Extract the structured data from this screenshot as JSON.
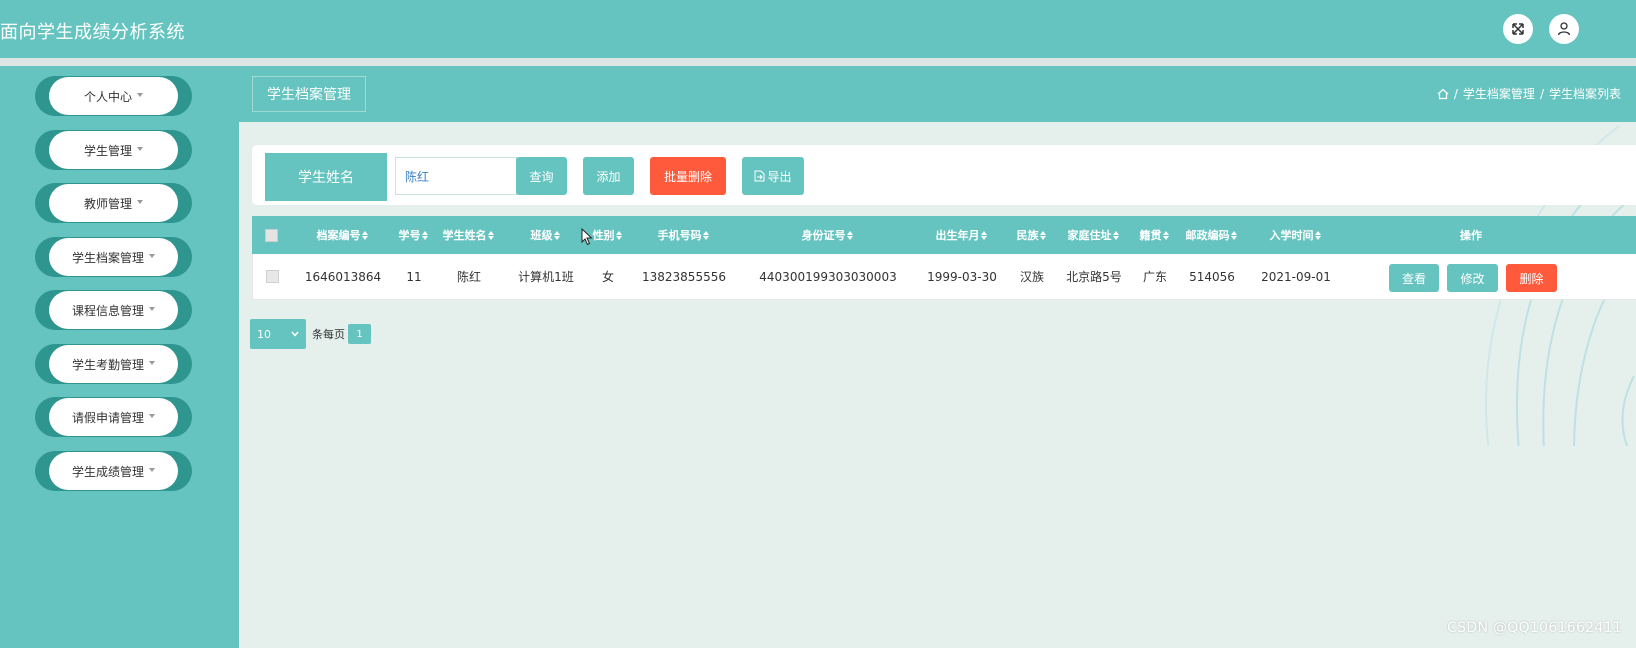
{
  "app": {
    "title": "面向学生成绩分析系统"
  },
  "topbar": {
    "fullscreen_icon": "fullscreen-icon",
    "user_icon": "user-icon"
  },
  "sidebar": {
    "items": [
      {
        "label": "个人中心"
      },
      {
        "label": "学生管理"
      },
      {
        "label": "教师管理"
      },
      {
        "label": "学生档案管理"
      },
      {
        "label": "课程信息管理"
      },
      {
        "label": "学生考勤管理"
      },
      {
        "label": "请假申请管理"
      },
      {
        "label": "学生成绩管理"
      }
    ]
  },
  "page": {
    "tag": "学生档案管理"
  },
  "breadcrumb": {
    "home_icon": "home-icon",
    "sep": "/",
    "level1": "学生档案管理",
    "level2": "学生档案列表"
  },
  "search": {
    "label": "学生姓名",
    "value": "陈红",
    "query_btn": "查询",
    "add_btn": "添加",
    "batch_delete_btn": "批量删除",
    "export_btn": "导出"
  },
  "table": {
    "columns": [
      "档案编号",
      "学号",
      "学生姓名",
      "班级",
      "性别",
      "手机号码",
      "身份证号",
      "出生年月",
      "民族",
      "家庭住址",
      "籍贯",
      "邮政编码",
      "入学时间",
      "操作"
    ],
    "rows": [
      {
        "cells": [
          "1646013864",
          "11",
          "陈红",
          "计算机1班",
          "女",
          "13823855556",
          "440300199303030003",
          "1999-03-30",
          "汉族",
          "北京路5号",
          "广东",
          "514056",
          "2021-09-01"
        ]
      }
    ],
    "actions": {
      "view": "查看",
      "edit": "修改",
      "delete": "删除"
    }
  },
  "pager": {
    "page_size": "10",
    "per_page_label": "条每页",
    "current_page": "1"
  },
  "watermark": "CSDN @QQ1061662411",
  "colors": {
    "primary": "#66c4c0",
    "sidebar_dark": "#2e958f",
    "danger": "#ff5a3c",
    "content_bg": "#e5f0ec"
  }
}
